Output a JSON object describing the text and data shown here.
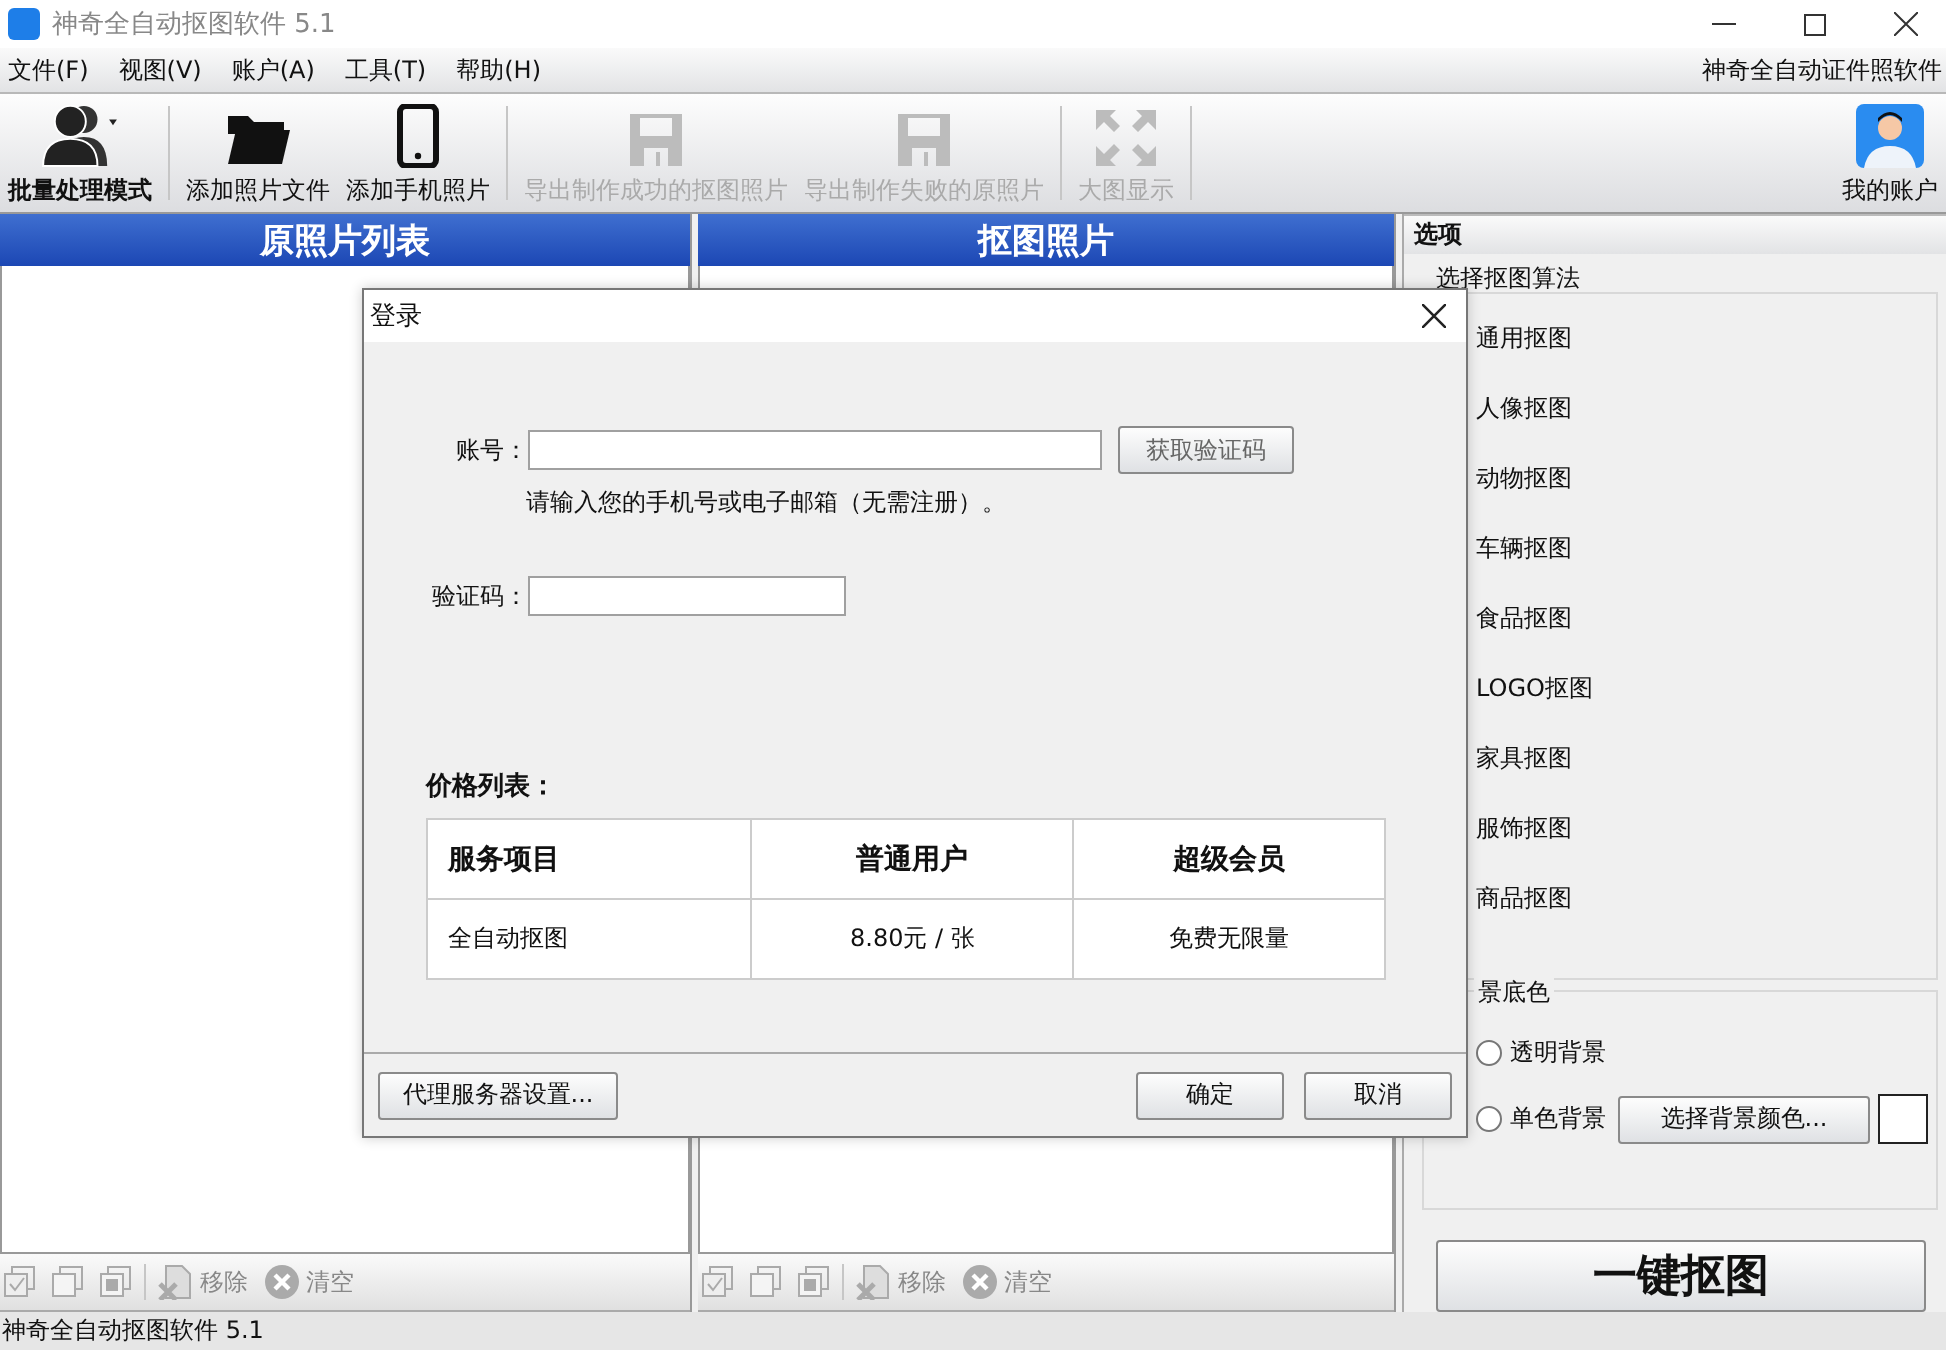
{
  "window": {
    "title": "神奇全自动抠图软件 5.1"
  },
  "menu": [
    {
      "label": "文件(F)"
    },
    {
      "label": "视图(V)"
    },
    {
      "label": "账户(A)"
    },
    {
      "label": "工具(T)"
    },
    {
      "label": "帮助(H)"
    }
  ],
  "menu_link": "神奇全自动证件照软件",
  "toolbar": [
    {
      "kind": "users",
      "label": "批量处理模式",
      "selected": true,
      "disabled": false
    },
    {
      "kind": "folder",
      "label": "添加照片文件",
      "selected": false,
      "disabled": false
    },
    {
      "kind": "phone",
      "label": "添加手机照片",
      "selected": false,
      "disabled": false
    },
    {
      "kind": "save",
      "label": "导出制作成功的抠图照片",
      "selected": false,
      "disabled": true
    },
    {
      "kind": "save",
      "label": "导出制作失败的原照片",
      "selected": false,
      "disabled": true
    },
    {
      "kind": "expand",
      "label": "大图显示",
      "selected": false,
      "disabled": true
    }
  ],
  "account_button": {
    "label": "我的账户"
  },
  "panels": [
    {
      "title": "原照片列表",
      "tools": [
        {
          "kind": "check-all",
          "disabled": true
        },
        {
          "kind": "select-none",
          "disabled": true
        },
        {
          "kind": "select-invert",
          "disabled": true
        },
        {
          "kind": "remove",
          "label": "移除",
          "disabled": true
        },
        {
          "kind": "clear",
          "label": "清空",
          "disabled": true
        }
      ]
    },
    {
      "title": "抠图照片",
      "tools": [
        {
          "kind": "check-all",
          "disabled": true
        },
        {
          "kind": "select-none",
          "disabled": true
        },
        {
          "kind": "select-invert",
          "disabled": true
        },
        {
          "kind": "remove",
          "label": "移除",
          "disabled": true
        },
        {
          "kind": "clear",
          "label": "清空",
          "disabled": true
        }
      ]
    }
  ],
  "options": {
    "title": "选项",
    "algorithm_group": "选择抠图算法",
    "algorithms": [
      {
        "label": "通用抠图"
      },
      {
        "label": "人像抠图"
      },
      {
        "label": "动物抠图"
      },
      {
        "label": "车辆抠图"
      },
      {
        "label": "食品抠图"
      },
      {
        "label": "LOGO抠图"
      },
      {
        "label": "家具抠图"
      },
      {
        "label": "服饰抠图"
      },
      {
        "label": "商品抠图"
      }
    ],
    "background_group": "景底色",
    "backgrounds": [
      {
        "label": "透明背景",
        "selected": false
      },
      {
        "label": "单色背景",
        "selected": false
      }
    ],
    "color_button": "选择背景颜色...",
    "run_button": "一键抠图"
  },
  "status_bar": "神奇全自动抠图软件 5.1",
  "dialog": {
    "title": "登录",
    "account_label": "账号：",
    "code_button": "获取验证码",
    "hint": "请输入您的手机号或电子邮箱（无需注册）。",
    "code_label": "验证码：",
    "price_title": "价格列表：",
    "price_columns": [
      "服务项目",
      "普通用户",
      "超级会员"
    ],
    "price_rows": [
      [
        "全自动抠图",
        "8.80元 / 张",
        "免费无限量"
      ]
    ],
    "buttons": {
      "proxy": "代理服务器设置...",
      "ok": "确定",
      "cancel": "取消"
    }
  }
}
